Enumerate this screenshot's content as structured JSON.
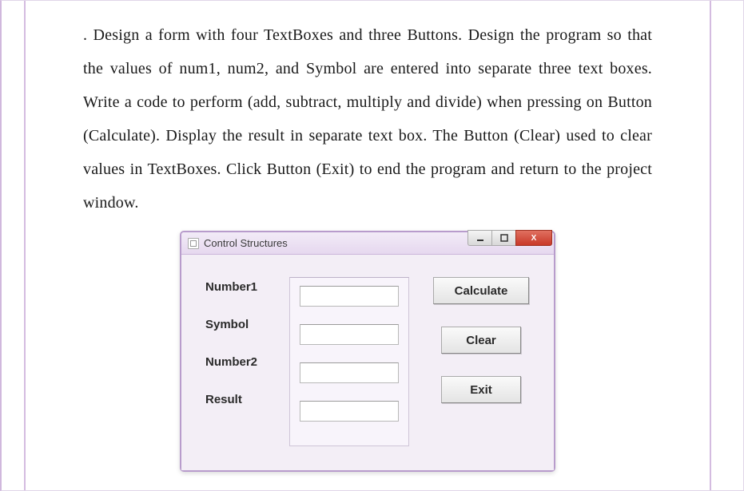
{
  "problem_text": ". Design a form with four TextBoxes and three Buttons. Design the program so that the values of num1, num2, and Symbol are entered into separate three text boxes. Write a code to perform (add, subtract, multiply and divide) when pressing on Button (Calculate). Display the result in separate text box. The Button (Clear) used to clear values in TextBoxes. Click Button (Exit) to end the program and return to the project window.",
  "window": {
    "title": "Control Structures",
    "close_glyph": "X"
  },
  "labels": {
    "number1": "Number1",
    "symbol": "Symbol",
    "number2": "Number2",
    "result": "Result"
  },
  "inputs": {
    "number1": "",
    "symbol": "",
    "number2": "",
    "result": ""
  },
  "buttons": {
    "calculate": "Calculate",
    "clear": "Clear",
    "exit": "Exit"
  }
}
